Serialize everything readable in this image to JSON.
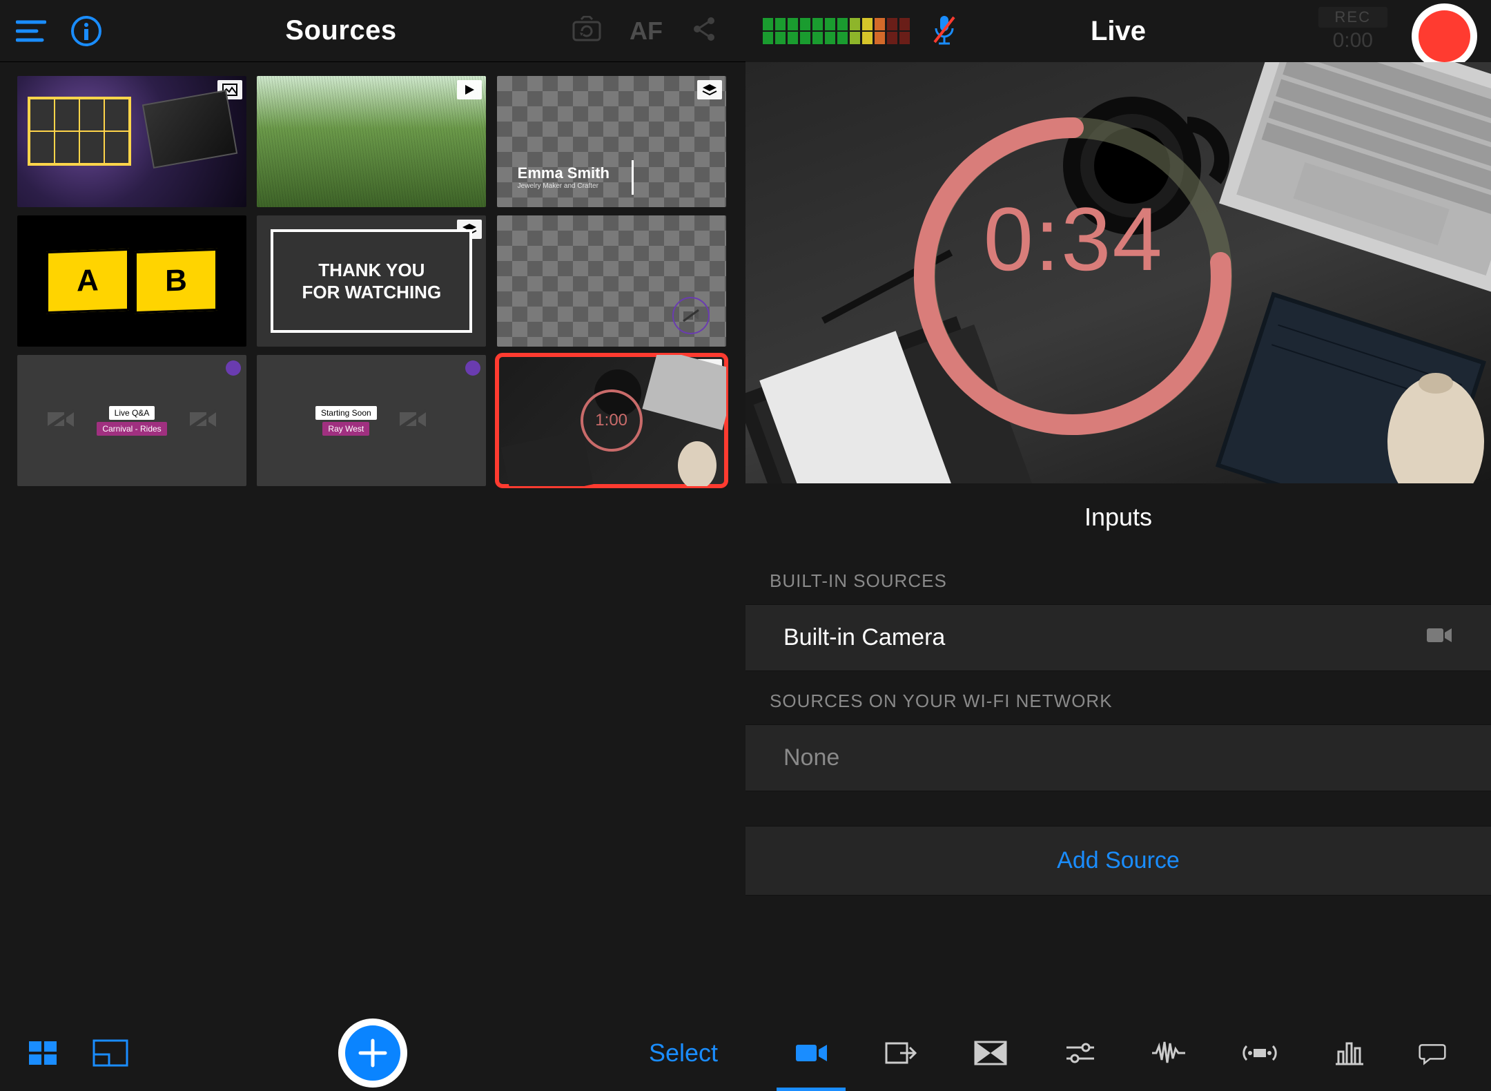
{
  "left": {
    "title": "Sources",
    "af_label": "AF",
    "select_label": "Select",
    "tiles": [
      {
        "badge_icon": "image-icon"
      },
      {
        "badge_icon": "play-icon"
      },
      {
        "badge_icon": "layers-icon",
        "line1": "Emma Smith",
        "line2": "Jewelry Maker and Crafter"
      },
      {
        "letter_a": "A",
        "letter_b": "B"
      },
      {
        "badge_icon": "layers-icon",
        "text": "THANK YOU\nFOR WATCHING"
      },
      {},
      {
        "label1": "Live Q&A",
        "label2": "Carnival - Rides"
      },
      {
        "label1": "Starting Soon",
        "label2": "Ray West"
      },
      {
        "badge_icon": "text-icon",
        "timer": "1:00",
        "selected": true
      }
    ]
  },
  "right": {
    "title": "Live",
    "rec_label": "REC",
    "rec_time": "0:00",
    "preview_timer": "0:34",
    "inputs_title": "Inputs",
    "section_builtin": "BUILT-IN SOURCES",
    "builtin_camera": "Built-in Camera",
    "section_wifi": "SOURCES ON YOUR WI-FI NETWORK",
    "wifi_none": "None",
    "add_source": "Add Source"
  },
  "colors": {
    "accent": "#1a8dff",
    "record": "#ff3b30",
    "timer": "#d97d7a"
  }
}
